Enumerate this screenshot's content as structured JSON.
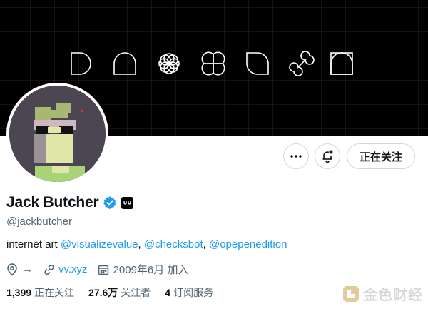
{
  "banner": {
    "icons": [
      "d-shape-icon",
      "rounded-square-icon",
      "flower-icon",
      "quatrefoil-icon",
      "arch-square-icon",
      "infinity-loop-icon",
      "framed-circle-icon"
    ]
  },
  "profile": {
    "display_name": "Jack Butcher",
    "handle": "@jackbutcher",
    "affiliate_badge": "vv",
    "bio_prefix": "internet art",
    "mentions": [
      "@visualizevalue",
      "@checksbot",
      "@opepenedition"
    ],
    "location": "→",
    "link": "vv.xyz",
    "joined": "2009年6月 加入"
  },
  "actions": {
    "following_label": "正在关注"
  },
  "stats": {
    "following_count": "1,399",
    "following_label": "正在关注",
    "followers_count": "27.6万",
    "followers_label": "关注者",
    "subscriptions_count": "4",
    "subscriptions_label": "订阅服务"
  },
  "watermark": {
    "text": "金色财经"
  },
  "colors": {
    "link": "#1d9bf0",
    "secondary_text": "#536471",
    "verified": "#1d9bf0"
  }
}
